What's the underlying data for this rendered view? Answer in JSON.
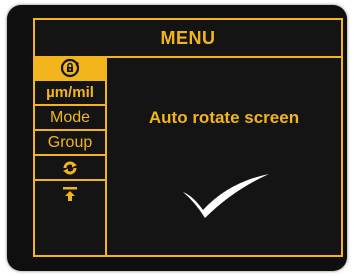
{
  "header": {
    "title": "MENU"
  },
  "sidebar": {
    "items": [
      {
        "icon": "rotate-lock-icon",
        "label": "",
        "active": true
      },
      {
        "label": "µm/mil"
      },
      {
        "label": "Mode"
      },
      {
        "label": "Group"
      },
      {
        "icon": "refresh-icon",
        "label": ""
      },
      {
        "icon": "upload-icon",
        "label": ""
      }
    ]
  },
  "content": {
    "title": "Auto rotate screen",
    "status_icon": "checkmark-icon"
  },
  "colors": {
    "accent": "#f2b51b",
    "background": "#141414"
  }
}
